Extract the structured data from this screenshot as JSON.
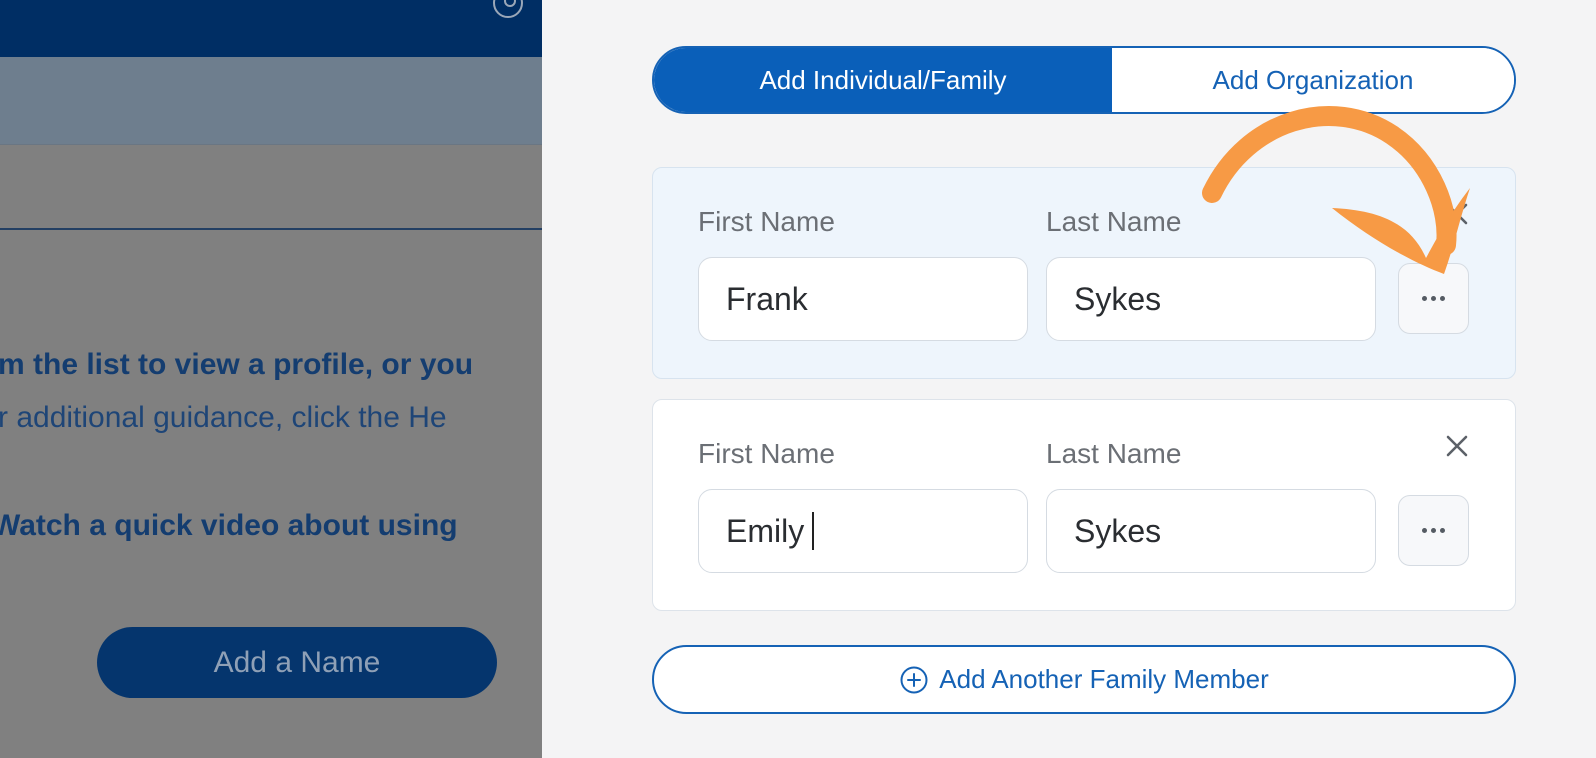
{
  "background": {
    "line1": "m the list to view a profile, or you",
    "line2": "r additional guidance, click the He",
    "line3": "Watch a quick video about using",
    "add_name_label": "Add a Name"
  },
  "panel": {
    "segmented": {
      "individual_label": "Add Individual/Family",
      "organization_label": "Add Organization",
      "selected": "Add Individual/Family"
    },
    "members": [
      {
        "first_name_label": "First Name",
        "last_name_label": "Last Name",
        "first_name_value": "Frank",
        "last_name_value": "Sykes"
      },
      {
        "first_name_label": "First Name",
        "last_name_label": "Last Name",
        "first_name_value": "Emily",
        "last_name_value": "Sykes"
      }
    ],
    "add_member_label": "Add Another Family Member"
  },
  "icons": {
    "more": "more-dots-icon",
    "close": "close-icon",
    "add": "plus-circle-icon",
    "annotation": "curved-arrow-icon",
    "user": "user-circle-icon"
  },
  "colors": {
    "primary": "#0a5fb9",
    "annotation_arrow": "#f79a45",
    "bg_topbar": "#002e64"
  }
}
